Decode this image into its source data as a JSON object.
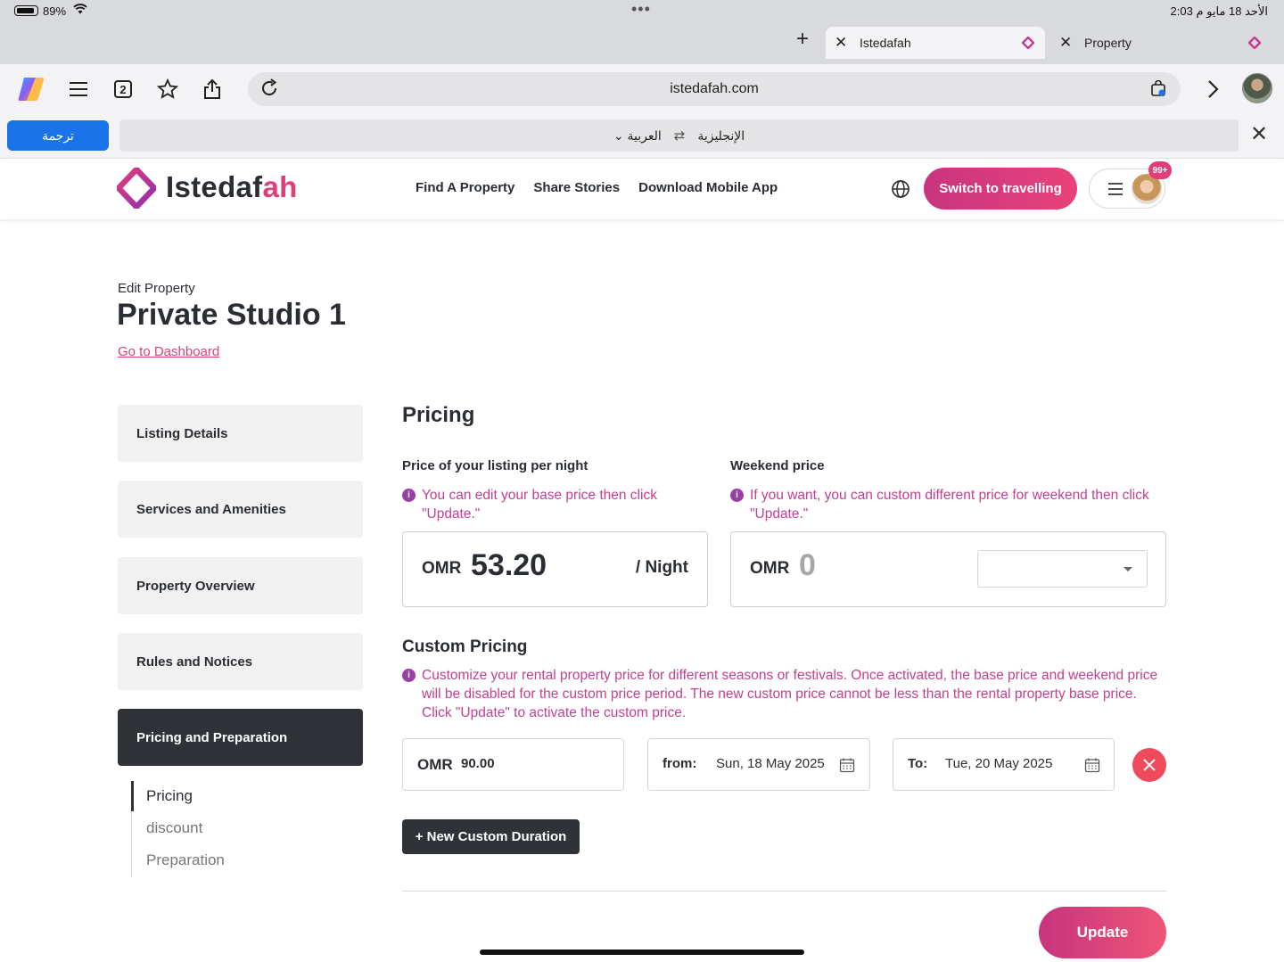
{
  "status_bar": {
    "battery": "89%",
    "time": "2:03",
    "date": "الأحد 18 مايو",
    "ampm": "م"
  },
  "browser_tabs": [
    {
      "title": "Istedafah",
      "active": true
    },
    {
      "title": "Property",
      "active": false
    }
  ],
  "toolbar": {
    "tab_count": "2",
    "url": "istedafah.com"
  },
  "translate_bar": {
    "button_label": "ترجمة",
    "from_lang": "الإنجليزية",
    "to_lang": "العربية"
  },
  "site_header": {
    "logo_main": "Istedaf",
    "logo_accent": "ah",
    "nav": [
      "Find A Property",
      "Share Stories",
      "Download Mobile App"
    ],
    "switch_label": "Switch to travelling",
    "notif_count": "99+",
    "brand_color": "#e23d79"
  },
  "page": {
    "edit_label": "Edit Property",
    "title": "Private Studio 1",
    "dashboard_link": "Go to Dashboard"
  },
  "sidebar": {
    "items": [
      {
        "label": "Listing Details"
      },
      {
        "label": "Services and Amenities"
      },
      {
        "label": "Property Overview"
      },
      {
        "label": "Rules and Notices"
      },
      {
        "label": "Pricing and Preparation",
        "active": true
      }
    ],
    "subitems": [
      {
        "label": "Pricing",
        "active": true
      },
      {
        "label": "discount"
      },
      {
        "label": "Preparation"
      }
    ]
  },
  "pricing": {
    "title": "Pricing",
    "base": {
      "label": "Price of your listing per night",
      "info": "You can edit your base price then click \"Update.\"",
      "currency": "OMR",
      "value": "53.20",
      "unit": "/ Night"
    },
    "weekend": {
      "label": "Weekend price",
      "info": "If you want, you can custom different price for weekend then click \"Update.\"",
      "currency": "OMR",
      "value": "0",
      "select_value": ""
    }
  },
  "custom_pricing": {
    "title": "Custom Pricing",
    "info": "Customize your rental property price for different seasons or festivals. Once activated, the base price and weekend price will be disabled for the custom price period. The new custom price cannot be less than the rental property base price. Click \"Update\" to activate the custom price.",
    "rows": [
      {
        "currency": "OMR",
        "price": "90.00",
        "from_label": "from:",
        "from_date": "Sun, 18 May 2025",
        "to_label": "To:",
        "to_date": "Tue, 20 May 2025"
      }
    ],
    "new_duration_label": "+ New Custom Duration"
  },
  "actions": {
    "update_label": "Update"
  }
}
